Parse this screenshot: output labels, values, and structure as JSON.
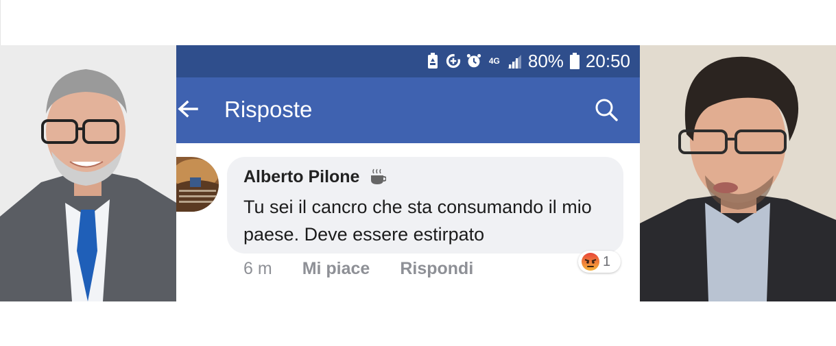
{
  "status_bar": {
    "network": "4G",
    "battery_percent": "80%",
    "time": "20:50"
  },
  "app_bar": {
    "title": "Risposte"
  },
  "comment": {
    "author": "Alberto Pilone",
    "text": "Tu sei il cancro che sta consumando il mio paese. Deve essere estirpato",
    "time": "6 m",
    "like_label": "Mi piace",
    "reply_label": "Rispondi",
    "reaction": {
      "type": "angry-icon",
      "count": "1"
    }
  },
  "colors": {
    "status_bar": "#2f4e8c",
    "app_bar": "#3f62b0",
    "bubble": "#f0f1f4",
    "action_text": "#8e9096",
    "angry": "#f0663a"
  }
}
